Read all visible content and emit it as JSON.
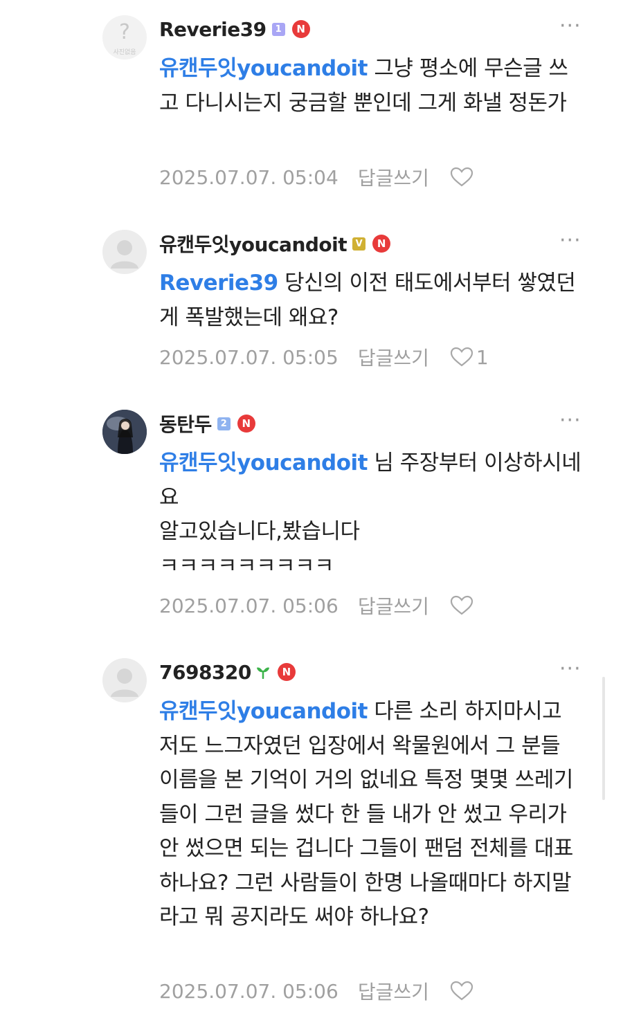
{
  "comments": [
    {
      "username": "Reverie39",
      "level": "1",
      "new_badge": "N",
      "avatar_label": "사진없음",
      "mention": "유캔두잇youcandoit",
      "text": "그냥 평소에 무슨글 쓰고 다니시는지 궁금할 뿐인데 그게 화낼 정돈가",
      "timestamp": "2025.07.07. 05:04",
      "reply_label": "답글쓰기",
      "like_count": ""
    },
    {
      "username": "유캔두잇youcandoit",
      "level": "V",
      "new_badge": "N",
      "mention": "Reverie39",
      "text": "당신의 이전 태도에서부터 쌓였던게 폭발했는데 왜요?",
      "timestamp": "2025.07.07. 05:05",
      "reply_label": "답글쓰기",
      "like_count": "1"
    },
    {
      "username": "동탄두",
      "level": "2",
      "new_badge": "N",
      "mention": "유캔두잇youcandoit",
      "text": "님 주장부터 이상하시네요\n알고있습니다,봤습니다\nㅋㅋㅋㅋㅋㅋㅋㅋㅋ",
      "timestamp": "2025.07.07. 05:06",
      "reply_label": "답글쓰기",
      "like_count": ""
    },
    {
      "username": "7698320",
      "new_badge": "N",
      "mention": "유캔두잇youcandoit",
      "text": "다른 소리 하지마시고 저도 느그자였던 입장에서 왁물원에서 그 분들 이름을 본 기억이 거의 없네요 특정 몇몇 쓰레기들이 그런 글을 썼다 한 들 내가 안 썼고 우리가 안 썼으면 되는 겁니다 그들이 팬덤 전체를 대표하나요? 그런 사람들이 한명 나올때마다 하지말라고 뭐 공지라도 써야 하나요?",
      "timestamp": "2025.07.07. 05:06",
      "reply_label": "답글쓰기",
      "like_count": ""
    }
  ],
  "more_menu_glyph": "···"
}
